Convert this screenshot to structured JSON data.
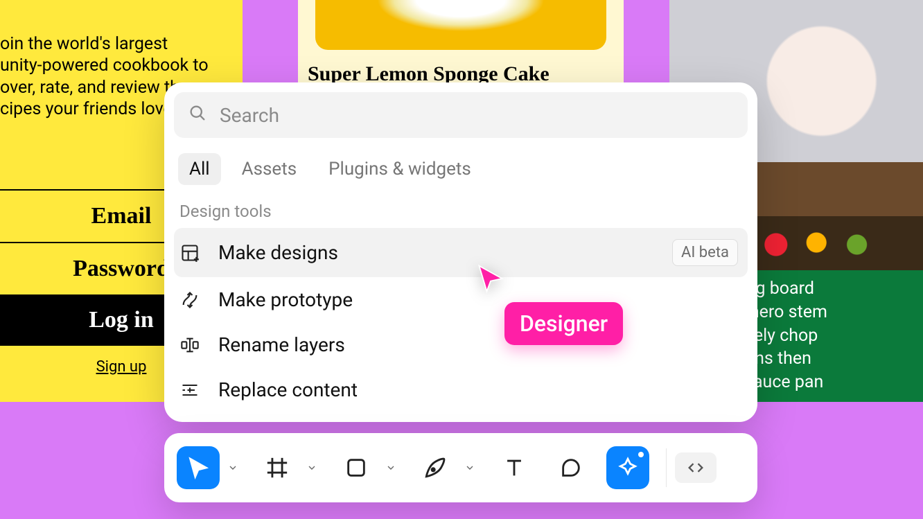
{
  "bg_left": {
    "desc": "oin the world's largest\nunity-powered cookbook to\nover, rate, and review the\ncipes your friends love",
    "email": "Email",
    "password": "Password",
    "login": "Log in",
    "signup": "Sign up"
  },
  "bg_center": {
    "recipe_title": "Super Lemon Sponge Cake"
  },
  "bg_right": {
    "instructions": "large cutting board\ne the habanero stem\neds and finely chop\nne the onions then\nnatoes in sauce pan"
  },
  "panel": {
    "search_placeholder": "Search",
    "tabs": {
      "all": "All",
      "assets": "Assets",
      "plugins": "Plugins & widgets"
    },
    "group_label": "Design tools",
    "items": {
      "make_designs": {
        "label": "Make designs",
        "badge": "AI beta"
      },
      "make_prototype": {
        "label": "Make prototype"
      },
      "rename_layers": {
        "label": "Rename layers"
      },
      "replace_content": {
        "label": "Replace content"
      }
    }
  },
  "cursor_tag": "Designer"
}
